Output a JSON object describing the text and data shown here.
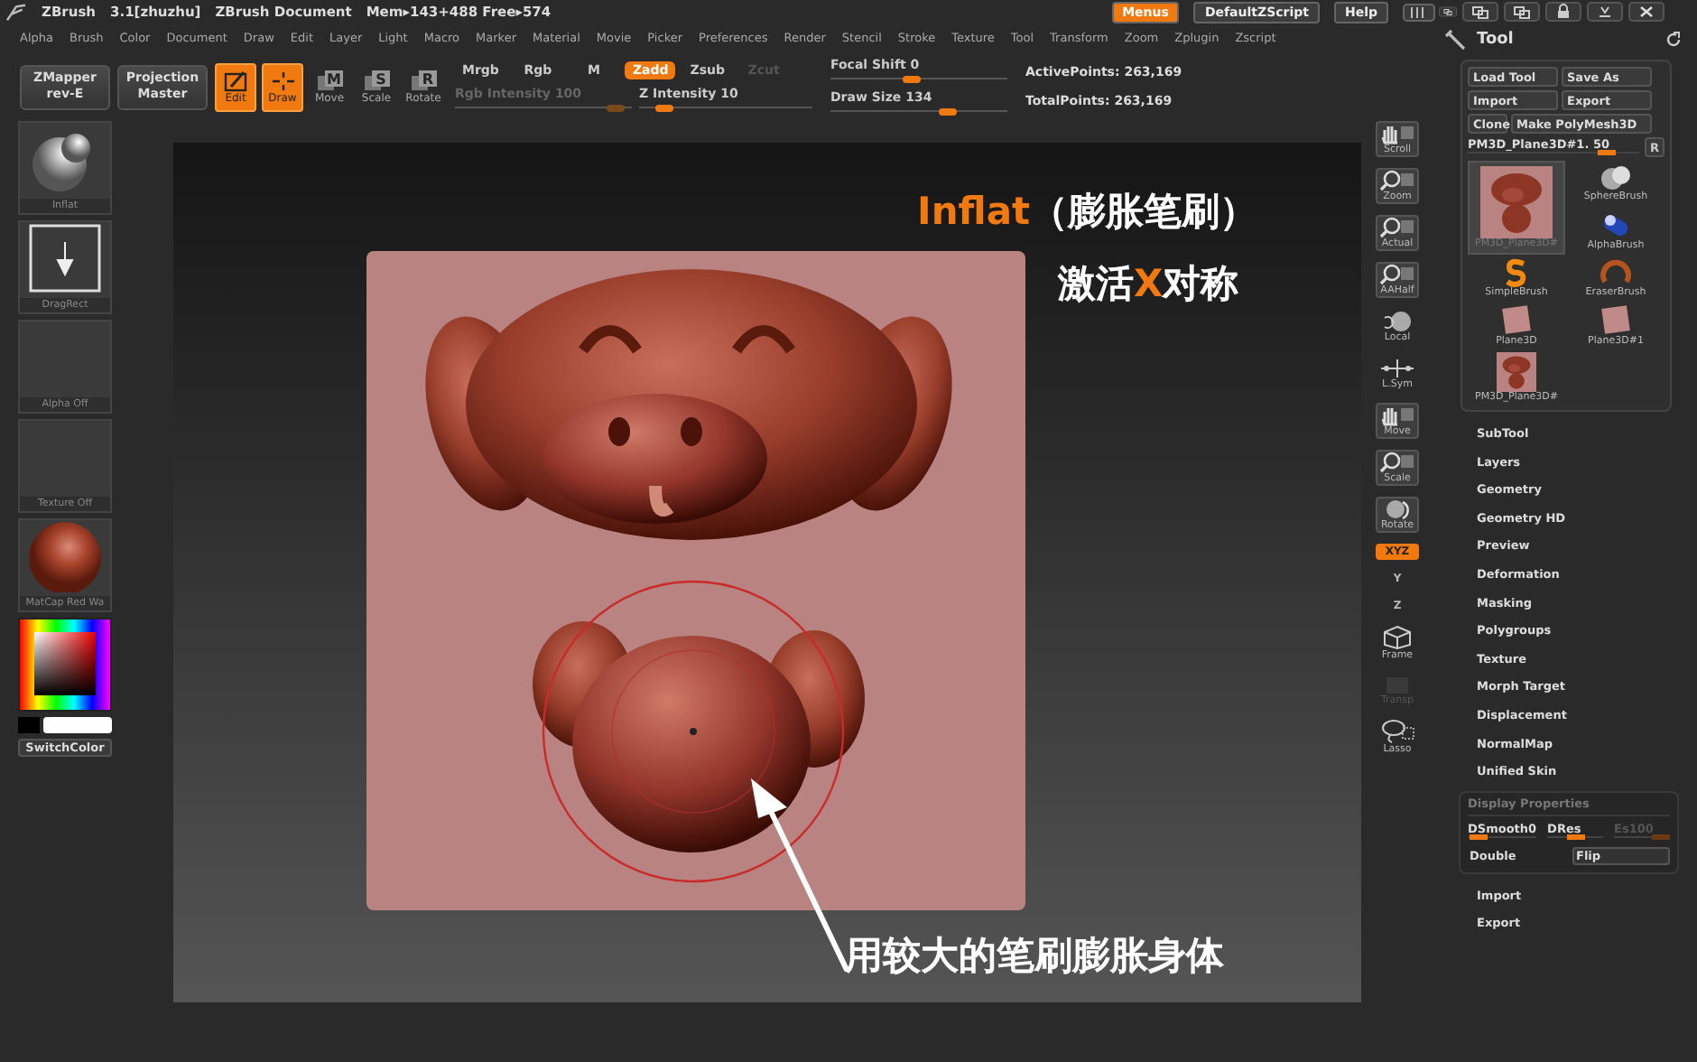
{
  "title_bar": {
    "app": "ZBrush",
    "version": "3.1[zhuzhu]",
    "document": "ZBrush Document",
    "memory": "Mem▸143+488 Free▸574",
    "buttons": [
      {
        "label": "Menus",
        "selected": true
      },
      {
        "label": "DefaultZScript",
        "selected": false
      },
      {
        "label": "Help",
        "selected": false
      }
    ]
  },
  "menu_bar": [
    "Alpha",
    "Brush",
    "Color",
    "Document",
    "Draw",
    "Edit",
    "Layer",
    "Light",
    "Macro",
    "Marker",
    "Material",
    "Movie",
    "Picker",
    "Preferences",
    "Render",
    "Stencil",
    "Stroke",
    "Texture",
    "Tool",
    "Transform",
    "Zoom",
    "Zplugin",
    "Zscript"
  ],
  "toolbar": {
    "plugins": [
      {
        "line1": "ZMapper",
        "line2": "rev-E"
      },
      {
        "line1": "Projection",
        "line2": "Master"
      }
    ],
    "modes": [
      {
        "kind": "edit",
        "label": "Edit",
        "selected": true
      },
      {
        "kind": "draw",
        "label": "Draw",
        "selected": true
      },
      {
        "kind": "cube",
        "glyph": "M",
        "label": "Move",
        "selected": false
      },
      {
        "kind": "cube",
        "glyph": "S",
        "label": "Scale",
        "selected": false
      },
      {
        "kind": "cube",
        "glyph": "R",
        "label": "Rotate",
        "selected": false
      }
    ],
    "color_modes": [
      {
        "label": "Mrgb",
        "selected": false
      },
      {
        "label": "Rgb",
        "selected": false
      },
      {
        "label": "M",
        "selected": false
      }
    ],
    "rgb_intensity": {
      "label": "Rgb Intensity",
      "value": "100",
      "disabled": true,
      "level": 0.95
    },
    "z_modes": [
      {
        "label": "Zadd",
        "selected": true,
        "disabled": false
      },
      {
        "label": "Zsub",
        "selected": false,
        "disabled": false
      },
      {
        "label": "Zcut",
        "selected": false,
        "disabled": true
      }
    ],
    "z_intensity": {
      "label": "Z Intensity",
      "value": "10",
      "level": 0.1
    },
    "focal_shift": {
      "label": "Focal Shift",
      "value": "0",
      "level": 0.45
    },
    "draw_size": {
      "label": "Draw Size",
      "value": "134",
      "level": 0.68
    },
    "stats": [
      {
        "label": "ActivePoints:",
        "value": "263,169"
      },
      {
        "label": "TotalPoints:",
        "value": "263,169"
      }
    ]
  },
  "left_panel": {
    "slots": [
      {
        "kind": "brush",
        "label": "Inflat"
      },
      {
        "kind": "stroke",
        "label": "DragRect"
      },
      {
        "kind": "empty",
        "label": "Alpha Off"
      },
      {
        "kind": "empty",
        "label": "Texture Off"
      },
      {
        "kind": "material",
        "label": "MatCap Red Wa"
      }
    ],
    "switch_color": "SwitchColor"
  },
  "canvas": {
    "title": {
      "accent": "Inflat",
      "rest": "（膨胀笔刷）"
    },
    "subtitle": {
      "before": "激活",
      "accent": "X",
      "after": "对称"
    },
    "caption": "用较大的笔刷膨胀身体"
  },
  "view_tools": [
    {
      "kind": "hand",
      "label": "Scroll",
      "framed": true,
      "selected": false,
      "disabled": false
    },
    {
      "kind": "magnifier",
      "label": "Zoom",
      "framed": true,
      "selected": false,
      "disabled": false
    },
    {
      "kind": "magnifier",
      "label": "Actual",
      "framed": true,
      "selected": false,
      "disabled": false
    },
    {
      "kind": "magnifier",
      "label": "AAHalf",
      "framed": true,
      "selected": false,
      "disabled": false
    },
    {
      "kind": "sphere",
      "label": "Local",
      "framed": false,
      "selected": false,
      "disabled": false
    },
    {
      "kind": "sym",
      "label": "L.Sym",
      "framed": false,
      "selected": false,
      "disabled": false
    },
    {
      "kind": "hand",
      "label": "Move",
      "framed": true,
      "selected": false,
      "disabled": false
    },
    {
      "kind": "magnifier",
      "label": "Scale",
      "framed": true,
      "selected": false,
      "disabled": false
    },
    {
      "kind": "rotate",
      "label": "Rotate",
      "framed": true,
      "selected": false,
      "disabled": false
    },
    {
      "kind": "axis",
      "label": "XYZ",
      "framed": false,
      "selected": true,
      "disabled": false
    },
    {
      "kind": "axis",
      "label": "Y",
      "framed": false,
      "selected": false,
      "disabled": false
    },
    {
      "kind": "axis",
      "label": "Z",
      "framed": false,
      "selected": false,
      "disabled": false
    },
    {
      "kind": "cube",
      "label": "Frame",
      "framed": false,
      "selected": false,
      "disabled": false
    },
    {
      "kind": "square",
      "label": "Transp",
      "framed": false,
      "selected": false,
      "disabled": true
    },
    {
      "kind": "lasso",
      "label": "Lasso",
      "framed": false,
      "selected": false,
      "disabled": false
    }
  ],
  "tool_palette": {
    "title": "Tool",
    "buttons": [
      "Load Tool",
      "Save As",
      "Import",
      "Export",
      "Clone",
      "Make PolyMesh3D"
    ],
    "current": {
      "label": "PM3D_Plane3D#1.",
      "value": "50",
      "level": 0.85,
      "reset": "R"
    },
    "tools": [
      {
        "kind": "sphere",
        "label": "SphereBrush",
        "selected": false
      },
      {
        "kind": "mesh-large",
        "label": "PM3D_Plane3D#",
        "selected": true
      },
      {
        "kind": "alpha",
        "label": "AlphaBrush",
        "selected": false
      },
      {
        "kind": "simple",
        "label": "SimpleBrush",
        "selected": false
      },
      {
        "kind": "eraser",
        "label": "EraserBrush",
        "selected": false
      },
      {
        "kind": "plane",
        "label": "Plane3D",
        "selected": false
      },
      {
        "kind": "plane",
        "label": "Plane3D#1",
        "selected": false
      },
      {
        "kind": "mesh",
        "label": "PM3D_Plane3D#",
        "selected": false
      }
    ],
    "subpalettes": [
      "SubTool",
      "Layers",
      "Geometry",
      "Geometry HD",
      "Preview",
      "Deformation",
      "Masking",
      "Polygroups",
      "Texture",
      "Morph Target",
      "Displacement",
      "NormalMap",
      "Unified Skin"
    ],
    "display_properties": {
      "title": "Display Properties",
      "sliders": [
        {
          "label": "DSmooth",
          "value": "0",
          "level": 0.05,
          "disabled": false
        },
        {
          "label": "DRes",
          "level": 0.5,
          "disabled": false
        },
        {
          "label": "Es",
          "value": "100",
          "level": 1,
          "disabled": true
        }
      ],
      "buttons": [
        {
          "kind": "plain",
          "label": "Double"
        },
        {
          "kind": "framed",
          "label": "Flip"
        }
      ]
    },
    "footer_items": [
      "Import",
      "Export"
    ]
  }
}
